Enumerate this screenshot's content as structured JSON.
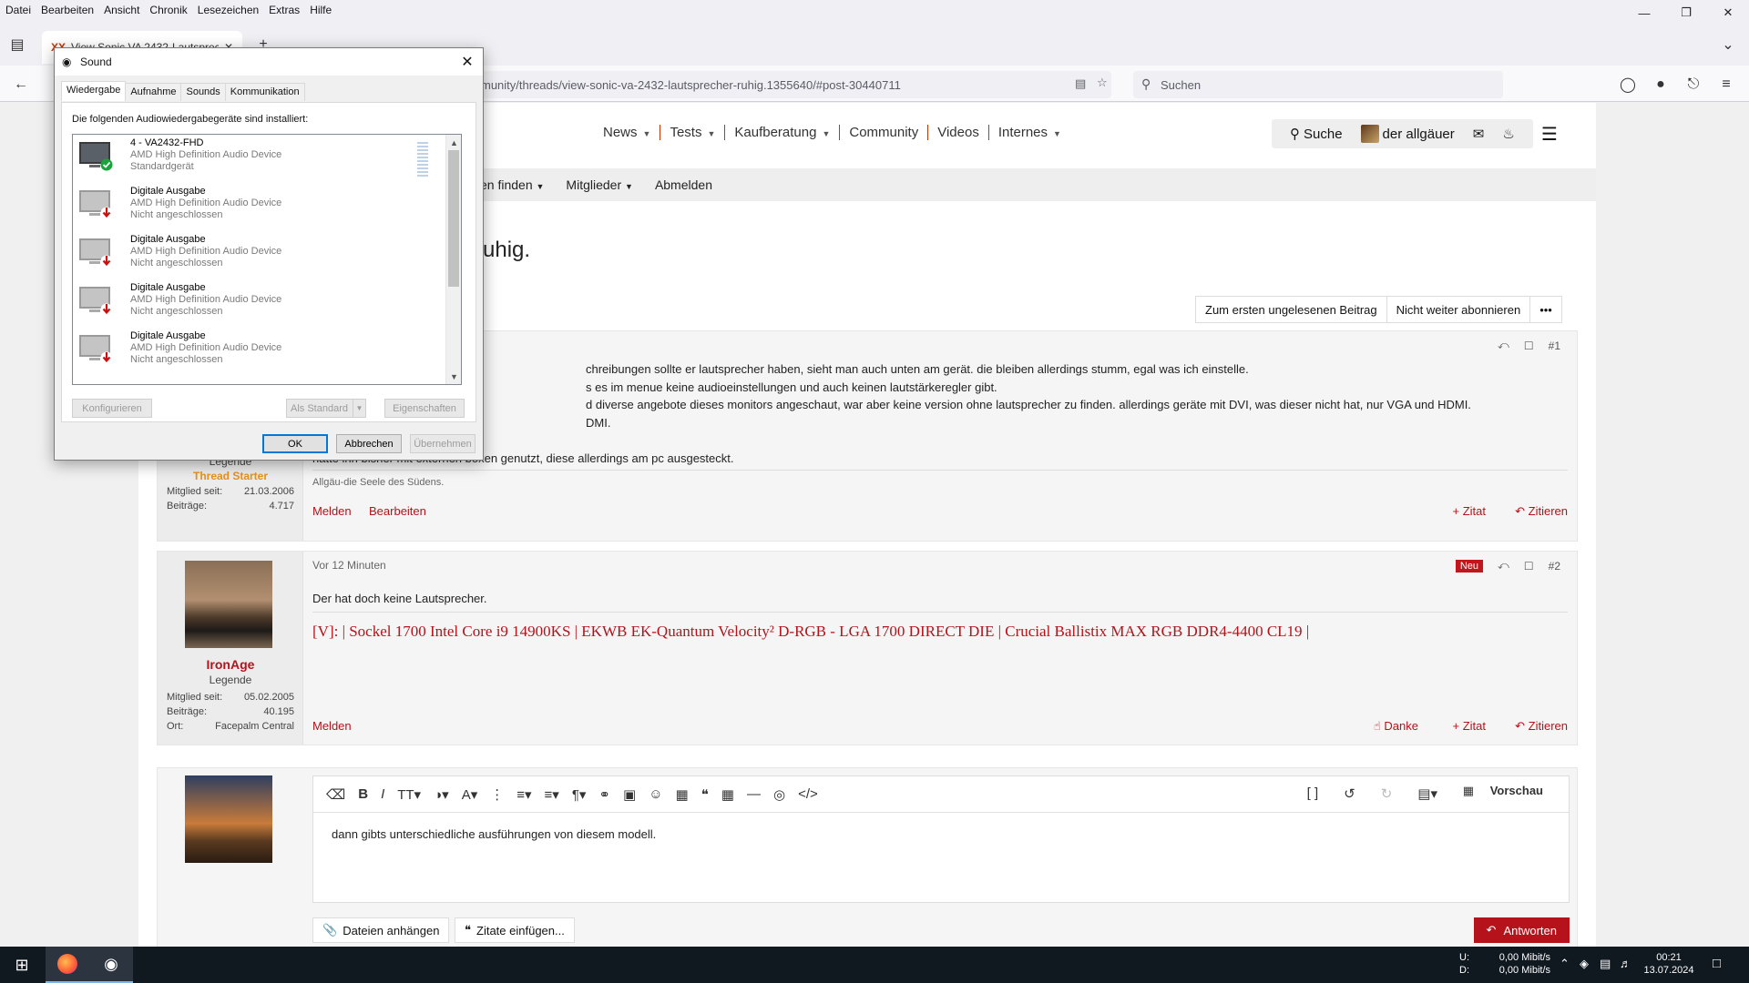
{
  "menubar": [
    "Datei",
    "Bearbeiten",
    "Ansicht",
    "Chronik",
    "Lesezeichen",
    "Extras",
    "Hilfe"
  ],
  "browser": {
    "tab_title": "View Sonic VA 2432-Lautsprech",
    "url": "munity/threads/view-sonic-va-2432-lautsprecher-ruhig.1355640/#post-30440711",
    "search_placeholder": "Suchen"
  },
  "site": {
    "nav": [
      "News",
      "Tests",
      "Kaufberatung",
      "Community",
      "Videos",
      "Internes"
    ],
    "search": "Suche",
    "user": "der allgäuer",
    "subnav": [
      "en finden",
      "Mitglieder",
      "Abmelden"
    ],
    "thread_title": "ruhig.",
    "actions": [
      "Zum ersten ungelesenen Beitrag",
      "Nicht weiter abonnieren",
      "•••"
    ]
  },
  "post1": {
    "index": "#1",
    "lines": [
      "chreibungen sollte er lautsprecher haben, sieht man auch unten am gerät. die bleiben allerdings stumm, egal was ich einstelle.",
      "s es im menue keine audioeinstellungen und auch keinen lautstärkeregler gibt.",
      "d diverse angebote dieses monitors angeschaut, war aber keine version ohne lautsprecher zu finden. allerdings geräte mit DVI, was dieser nicht hat, nur VGA und HDMI.",
      "DMI.",
      "",
      "hatte ihn bisher mit externen boxen genutzt, diese allerdings am pc ausgesteckt."
    ],
    "signature": "Allgäu-die Seele des Südens.",
    "user_role": "Legende",
    "starter": "Thread Starter",
    "stats": [
      {
        "label": "Mitglied seit:",
        "value": "21.03.2006"
      },
      {
        "label": "Beiträge:",
        "value": "4.717"
      }
    ],
    "foot_left": [
      "Melden",
      "Bearbeiten"
    ],
    "foot_right": [
      "+ Zitat",
      "Zitieren"
    ]
  },
  "post2": {
    "time": "Vor 12 Minuten",
    "badge": "Neu",
    "index": "#2",
    "text": "Der hat doch keine Lautsprecher.",
    "signature": "[V]: | Sockel 1700 Intel Core i9 14900KS | EKWB EK-Quantum Velocity² D-RGB - LGA 1700 DIRECT DIE | Crucial Ballistix MAX RGB DDR4-4400 CL19 |",
    "username": "IronAge",
    "role": "Legende",
    "stats": [
      {
        "label": "Mitglied seit:",
        "value": "05.02.2005"
      },
      {
        "label": "Beiträge:",
        "value": "40.195"
      },
      {
        "label": "Ort:",
        "value": "Facepalm Central"
      }
    ],
    "foot_left": "Melden",
    "foot_right": [
      "Danke",
      "+ Zitat",
      "Zitieren"
    ]
  },
  "reply": {
    "text": "dann gibts unterschiedliche ausführungen von diesem modell.",
    "preview": "Vorschau",
    "attach": "Dateien anhängen",
    "quotes": "Zitate einfügen...",
    "submit": "Antworten"
  },
  "sound": {
    "title": "Sound",
    "tabs": [
      "Wiedergabe",
      "Aufnahme",
      "Sounds",
      "Kommunikation"
    ],
    "intro": "Die folgenden Audiowiedergabegeräte sind installiert:",
    "devices": [
      {
        "name": "4 - VA2432-FHD",
        "driver": "AMD High Definition Audio Device",
        "status": "Standardgerät",
        "default": true
      },
      {
        "name": "Digitale Ausgabe",
        "driver": "AMD High Definition Audio Device",
        "status": "Nicht angeschlossen",
        "default": false
      },
      {
        "name": "Digitale Ausgabe",
        "driver": "AMD High Definition Audio Device",
        "status": "Nicht angeschlossen",
        "default": false
      },
      {
        "name": "Digitale Ausgabe",
        "driver": "AMD High Definition Audio Device",
        "status": "Nicht angeschlossen",
        "default": false
      },
      {
        "name": "Digitale Ausgabe",
        "driver": "AMD High Definition Audio Device",
        "status": "Nicht angeschlossen",
        "default": false
      }
    ],
    "configure": "Konfigurieren",
    "set_default": "Als Standard",
    "properties": "Eigenschaften",
    "ok": "OK",
    "cancel": "Abbrechen",
    "apply": "Übernehmen"
  },
  "taskbar": {
    "net_up_label": "U:",
    "net_down_label": "D:",
    "net_up": "0,00 Mibit/s",
    "net_down": "0,00 Mibit/s",
    "time": "00:21",
    "date": "13.07.2024"
  },
  "colors": {
    "accent": "#b5121b",
    "dialog_focus": "#0078d7"
  }
}
